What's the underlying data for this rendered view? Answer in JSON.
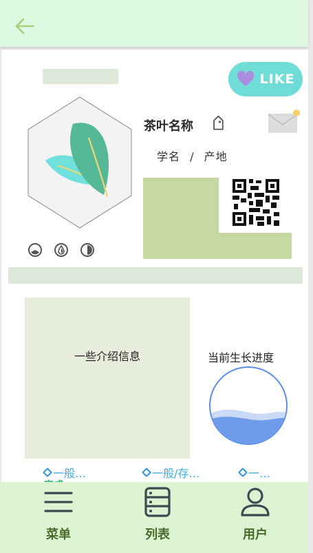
{
  "header": {
    "back_icon": "arrow-left-icon",
    "color": "#dcf8e1"
  },
  "profile": {
    "like_label": "LIKE",
    "like_color": "#6fdcd7",
    "tea_name": "茶叶名称",
    "scientific_line": "学名 / 产地",
    "status_icons": [
      "moon-icon",
      "drop-icon",
      "half-circle-icon"
    ]
  },
  "intro": {
    "text": "一些介绍信息"
  },
  "progress": {
    "title": "当前生长进度",
    "level": 0.25,
    "color": "#5b8ee6"
  },
  "tabs": [
    {
      "label": "一般…"
    },
    {
      "label": "一般/存…"
    },
    {
      "label": "一…"
    }
  ],
  "done_label": "完成",
  "nav": [
    {
      "label": "菜单",
      "icon": "menu-icon"
    },
    {
      "label": "列表",
      "icon": "list-icon"
    },
    {
      "label": "用户",
      "icon": "user-icon"
    }
  ]
}
